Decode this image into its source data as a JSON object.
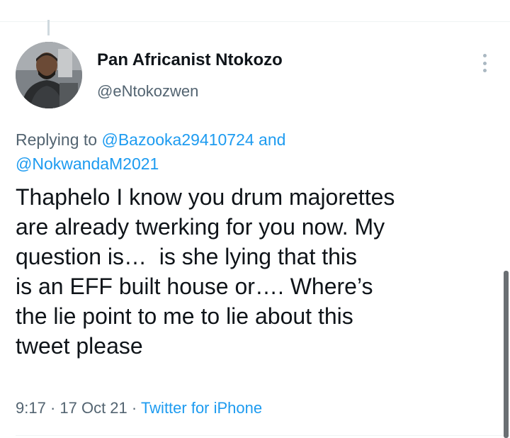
{
  "user": {
    "display_name": "Pan Africanist Ntokozo",
    "handle": "@eNtokozwen"
  },
  "reply": {
    "prefix": "Replying to ",
    "mention_1": "@Bazooka29410724",
    "connector": " and",
    "mention_2": "@NokwandaM2021"
  },
  "tweet": {
    "lines": [
      "Thaphelo I know you drum majorettes",
      "are already twerking for you now. My",
      "question is…  is she lying that this",
      "is an EFF built house or…. Where’s",
      "the lie point to me to lie about this",
      "tweet please"
    ]
  },
  "meta": {
    "time": "9:17",
    "separator_1": " · ",
    "date": "17 Oct 21",
    "separator_2": " · ",
    "source": "Twitter for iPhone"
  },
  "icons": {
    "more": "more-vertical-icon",
    "avatar": "profile-photo"
  },
  "colors": {
    "link": "#1d9bf0",
    "secondary_text": "#536471",
    "primary_text": "#0f1419"
  }
}
